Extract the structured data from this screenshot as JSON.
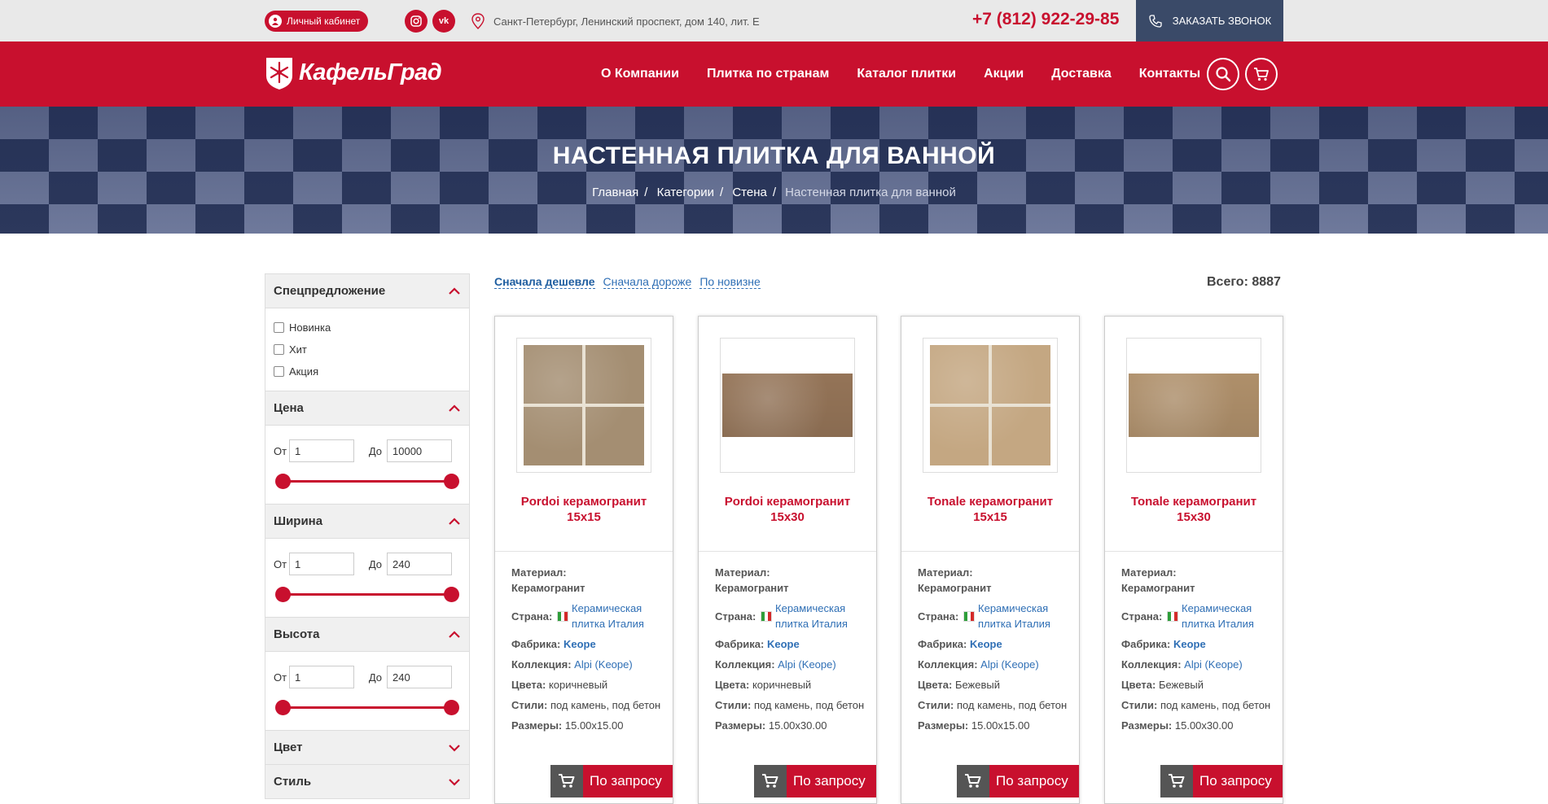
{
  "topbar": {
    "cabinet_label": "Личный кабинет",
    "social": [
      {
        "name": "instagram-icon",
        "glyph": "◎"
      },
      {
        "name": "vk-icon",
        "glyph": "vk"
      }
    ],
    "address": "Санкт-Петербург, Ленинский проспект, дом 140, лит. Е",
    "phone": "+7 (812) 922-29-85",
    "callback_label": "ЗАКАЗАТЬ ЗВОНОК"
  },
  "nav": {
    "logo_text": "КафельГрад",
    "items": [
      "О Компании",
      "Плитка по странам",
      "Каталог плитки",
      "Акции",
      "Доставка",
      "Контакты"
    ]
  },
  "hero": {
    "title": "НАСТЕННАЯ ПЛИТКА ДЛЯ ВАННОЙ",
    "breadcrumb": [
      "Главная",
      "Категории",
      "Стена",
      "Настенная плитка для ванной"
    ]
  },
  "filters": {
    "special": {
      "title": "Спецпредложение",
      "options": [
        "Новинка",
        "Хит",
        "Акция"
      ]
    },
    "price": {
      "title": "Цена",
      "from_label": "От",
      "to_label": "До",
      "from": "1",
      "to": "10000"
    },
    "width": {
      "title": "Ширина",
      "from_label": "От",
      "to_label": "До",
      "from": "1",
      "to": "240"
    },
    "height": {
      "title": "Высота",
      "from_label": "От",
      "to_label": "До",
      "from": "1",
      "to": "240"
    },
    "color": {
      "title": "Цвет"
    },
    "style": {
      "title": "Стиль"
    }
  },
  "sort": {
    "options": [
      "Сначала дешевле",
      "Сначала дороже",
      "По новизне"
    ],
    "total": "Всего: 8887"
  },
  "labels": {
    "material": "Материал:",
    "country": "Страна:",
    "factory": "Фабрика:",
    "collection": "Коллекция:",
    "colors": "Цвета:",
    "styles": "Стили:",
    "sizes": "Размеры:",
    "request": "По запросу"
  },
  "products": [
    {
      "title": "Pordoi керамогранит 15x15",
      "material": "Керамогранит",
      "country": "Керамическая плитка Италия",
      "factory": "Keope",
      "collection": "Alpi (Keope)",
      "colors": "коричневый",
      "styles": "под камень, под бетон",
      "sizes": "15.00x15.00",
      "swatch": "#a48e72",
      "shape": "square"
    },
    {
      "title": "Pordoi керамогранит 15x30",
      "material": "Керамогранит",
      "country": "Керамическая плитка Италия",
      "factory": "Keope",
      "collection": "Alpi (Keope)",
      "colors": "коричневый",
      "styles": "под камень, под бетон",
      "sizes": "15.00x30.00",
      "swatch": "#9c7a5c",
      "shape": "rect"
    },
    {
      "title": "Tonale керамогранит 15x15",
      "material": "Керамогранит",
      "country": "Керамическая плитка Италия",
      "factory": "Keope",
      "collection": "Alpi (Keope)",
      "colors": "Бежевый",
      "styles": "под камень, под бетон",
      "sizes": "15.00x15.00",
      "swatch": "#c4a782",
      "shape": "square"
    },
    {
      "title": "Tonale керамогранит 15x30",
      "material": "Керамогранит",
      "country": "Керамическая плитка Италия",
      "factory": "Keope",
      "collection": "Alpi (Keope)",
      "colors": "Бежевый",
      "styles": "под камень, под бетон",
      "sizes": "15.00x30.00",
      "swatch": "#b89770",
      "shape": "rect"
    }
  ]
}
